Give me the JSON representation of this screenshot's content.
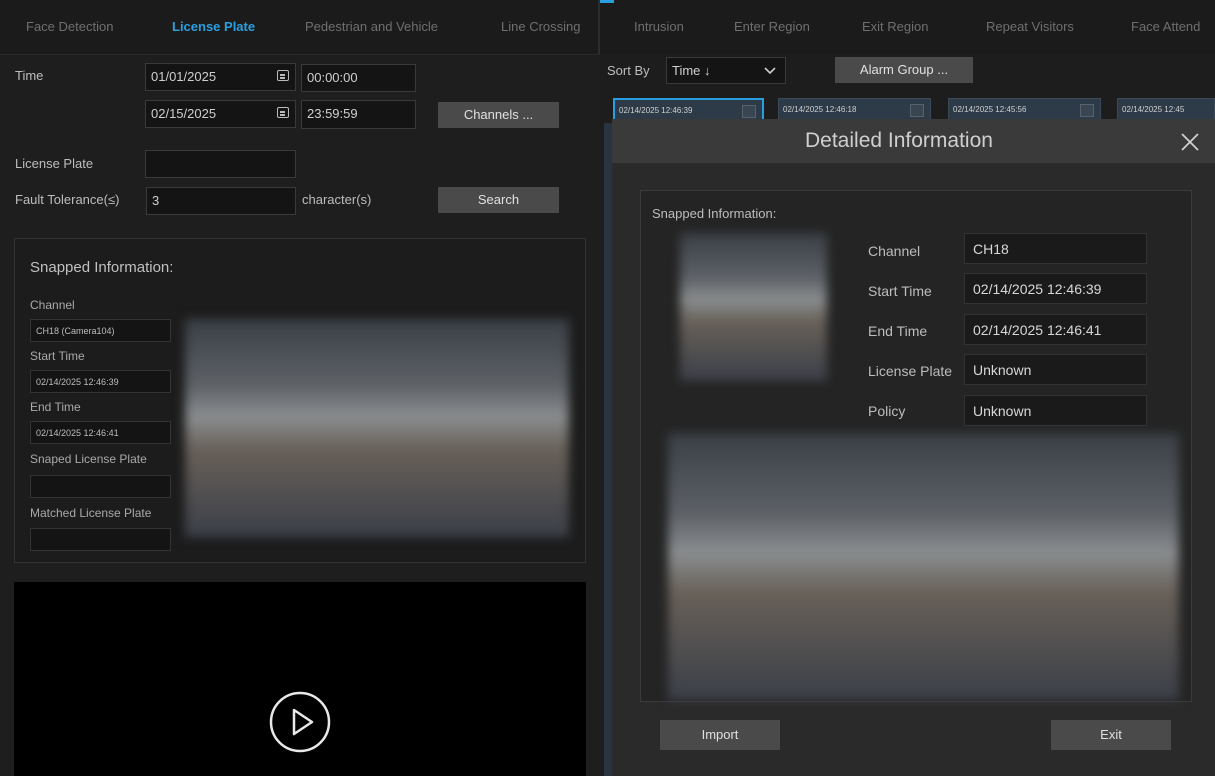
{
  "nav": {
    "tabs": [
      "Face Detection",
      "License Plate",
      "Pedestrian and Vehicle",
      "Line Crossing",
      "Intrusion",
      "Enter Region",
      "Exit Region",
      "Repeat Visitors",
      "Face Attend"
    ],
    "active": "License Plate"
  },
  "search": {
    "time_label": "Time",
    "start_date": "01/01/2025",
    "start_time": "00:00:00",
    "end_date": "02/15/2025",
    "end_time": "23:59:59",
    "channels_button": "Channels ...",
    "license_plate_label": "License Plate",
    "license_plate_value": "",
    "fault_tolerance_label": "Fault Tolerance(≤)",
    "fault_tolerance_value": "3",
    "fault_tolerance_unit": "character(s)",
    "search_button": "Search"
  },
  "snapped_left": {
    "title": "Snapped Information:",
    "channel_label": "Channel",
    "channel_value": "CH18 (Camera104)",
    "start_label": "Start Time",
    "start_value": "02/14/2025 12:46:39",
    "end_label": "End Time",
    "end_value": "02/14/2025 12:46:41",
    "snaped_plate_label": "Snaped License Plate",
    "snaped_plate_value": "",
    "matched_plate_label": "Matched License Plate",
    "matched_plate_value": ""
  },
  "results": {
    "sort_label": "Sort By",
    "sort_value": "Time ↓",
    "alarm_group_button": "Alarm Group ...",
    "thumbs": [
      "02/14/2025 12:46:39",
      "02/14/2025 12:46:18",
      "02/14/2025 12:45:56",
      "02/14/2025 12:45"
    ]
  },
  "dialog": {
    "title": "Detailed Information",
    "section_title": "Snapped Information:",
    "channel_label": "Channel",
    "channel_value": "CH18",
    "start_label": "Start Time",
    "start_value": "02/14/2025 12:46:39",
    "end_label": "End Time",
    "end_value": "02/14/2025 12:46:41",
    "plate_label": "License Plate",
    "plate_value": "Unknown",
    "policy_label": "Policy",
    "policy_value": "Unknown",
    "import_button": "Import",
    "exit_button": "Exit"
  },
  "colors": {
    "accent": "#2a9fe0",
    "background": "#1e1e1e"
  },
  "icons": [
    "calendar-icon",
    "chevron-down-icon",
    "close-icon",
    "play-icon",
    "cursor-icon"
  ]
}
